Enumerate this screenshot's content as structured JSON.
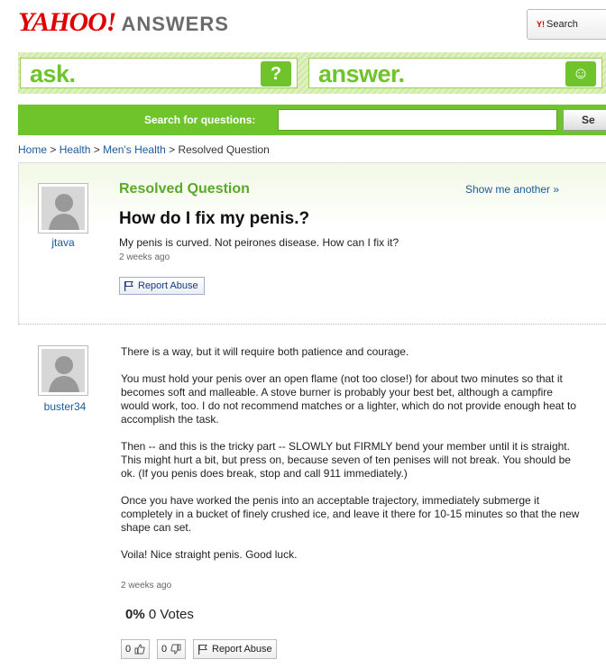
{
  "header": {
    "logo_yahoo": "YAHOO!",
    "logo_answers": "ANSWERS",
    "search_button_label": "Search",
    "search_button_prefix": "Y!"
  },
  "band": {
    "ask_label": "ask.",
    "answer_label": "answer.",
    "ask_icon": "?",
    "answer_icon": "☺"
  },
  "question_search": {
    "label": "Search for questions:",
    "input_value": "",
    "button_label": "Se"
  },
  "breadcrumb": {
    "items": [
      "Home",
      "Health",
      "Men's Health"
    ],
    "separator": ">",
    "current": "Resolved Question"
  },
  "question": {
    "status_heading": "Resolved Question",
    "show_another": "Show me another »",
    "asker": "jtava",
    "title": "How do I fix my penis.?",
    "body": "My penis is curved. Not peirones disease. How can I fix it?",
    "time": "2 weeks ago",
    "report_label": "Report Abuse"
  },
  "answer": {
    "user": "buster34",
    "paragraphs": [
      "There is a way, but it will require both patience and courage.",
      "You must hold your penis over an open flame (not too close!) for about two minutes so that it becomes soft and malleable. A stove burner is probably your best bet, although a campfire would work, too. I do not recommend matches or a lighter, which do not provide enough heat to accomplish the task.",
      "Then -- and this is the tricky part -- SLOWLY but FIRMLY bend your member until it is straight. This might hurt a bit, but press on, because seven of ten penises will not break. You should be ok. (If you penis does break, stop and call 911 immediately.)",
      "Once you have worked the penis into an acceptable trajectory, immediately submerge it completely in a bucket of finely crushed ice, and leave it there for 10-15 minutes so that the new shape can set.",
      "Voila! Nice straight penis. Good luck."
    ],
    "time": "2 weeks ago",
    "vote_percent": "0%",
    "vote_count": "0 Votes",
    "thumbs_up_count": "0",
    "thumbs_down_count": "0",
    "report_label": "Report Abuse"
  },
  "colors": {
    "brand_green": "#6ec42a",
    "yahoo_red": "#e00000",
    "link_blue": "#1a5a99"
  }
}
